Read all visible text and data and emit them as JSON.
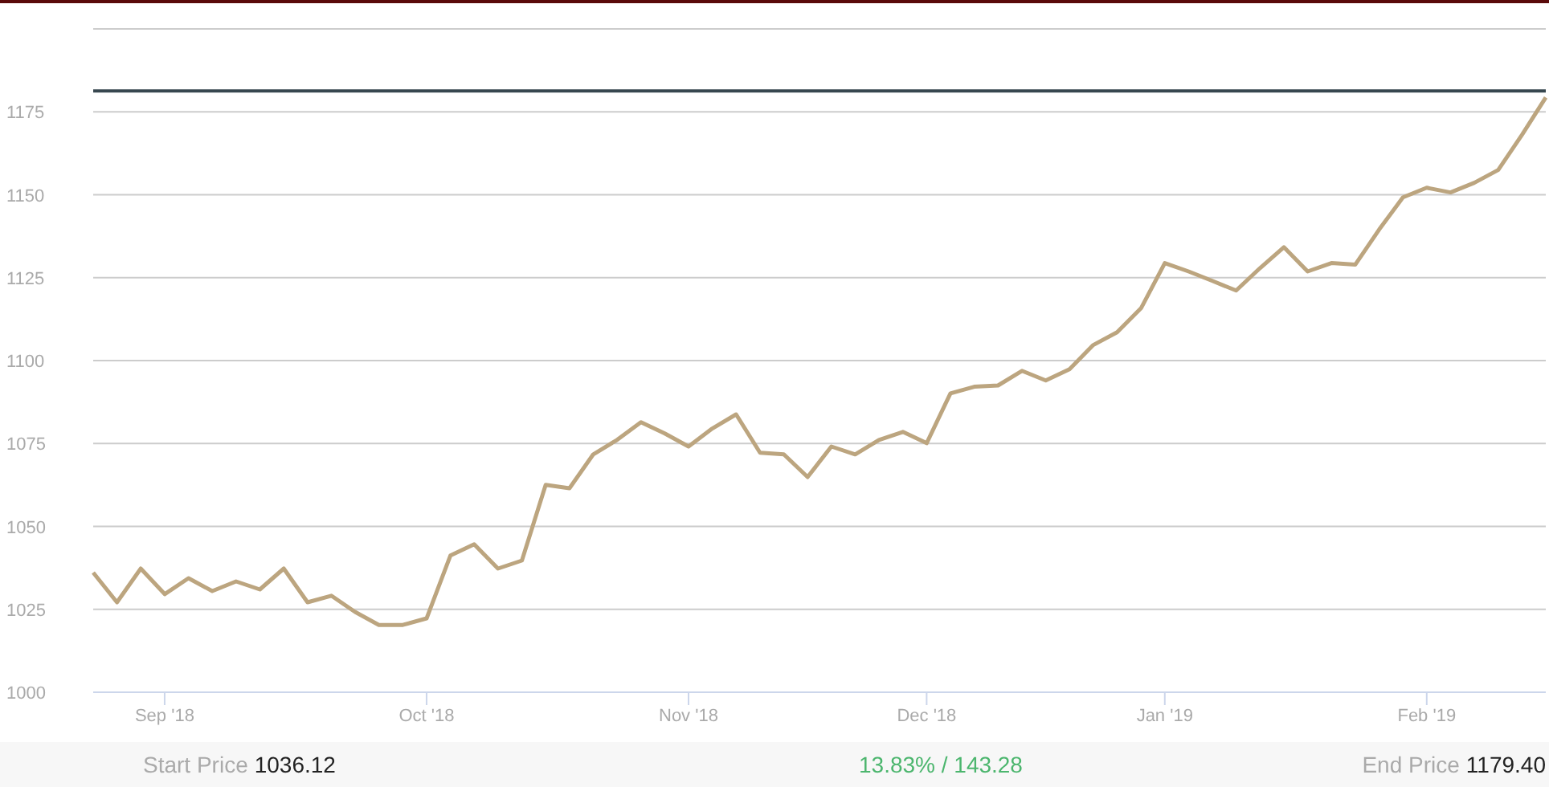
{
  "chart": {
    "chart_data": {
      "type": "line",
      "categories": [
        null,
        null,
        null,
        "Sep '18",
        null,
        null,
        null,
        null,
        null,
        null,
        null,
        null,
        null,
        null,
        "Oct '18",
        null,
        null,
        null,
        null,
        null,
        null,
        null,
        null,
        null,
        null,
        "Nov '18",
        null,
        null,
        null,
        null,
        null,
        null,
        null,
        null,
        null,
        "Dec '18",
        null,
        null,
        null,
        null,
        null,
        null,
        null,
        null,
        null,
        "Jan '19",
        null,
        null,
        null,
        null,
        null,
        null,
        null,
        null,
        null,
        null,
        "Feb '19",
        null,
        null,
        null,
        null,
        null
      ],
      "series": [
        {
          "color": "#bca57f",
          "values": [
            1036.1,
            1027.1,
            1037.3,
            1029.6,
            1034.4,
            1030.5,
            1033.4,
            1031.0,
            1037.3,
            1027.1,
            1029.1,
            1024.2,
            1020.3,
            1020.3,
            1022.3,
            1041.2,
            1044.6,
            1037.3,
            1039.7,
            1062.5,
            1061.5,
            1071.7,
            1076.1,
            1081.4,
            1078.0,
            1074.1,
            1079.5,
            1083.8,
            1072.2,
            1071.7,
            1064.9,
            1074.1,
            1071.7,
            1076.1,
            1078.5,
            1075.1,
            1090.1,
            1092.1,
            1092.5,
            1096.9,
            1094.0,
            1097.4,
            1104.7,
            1108.5,
            1115.8,
            1129.4,
            1126.9,
            1124.0,
            1121.1,
            1127.9,
            1134.2,
            1126.9,
            1129.4,
            1128.9,
            1139.5,
            1149.2,
            1152.1,
            1150.7,
            1153.6,
            1157.5,
            1168.1,
            1179.3
          ]
        },
        {
          "color": "#37474f",
          "values": [
            1181.3,
            1181.3,
            1181.3,
            1181.3,
            1181.3,
            1181.3,
            1181.3,
            1181.3,
            1181.3,
            1181.3,
            1181.3,
            1181.3,
            1181.3,
            1181.3,
            1181.3,
            1181.3,
            1181.3,
            1181.3,
            1181.3,
            1181.3,
            1181.3,
            1181.3,
            1181.3,
            1181.3,
            1181.3,
            1181.3,
            1181.3,
            1181.3,
            1181.3,
            1181.3,
            1181.3,
            1181.3,
            1181.3,
            1181.3,
            1181.3,
            1181.3,
            1181.3,
            1181.3,
            1181.3,
            1181.3,
            1181.3,
            1181.3,
            1181.3,
            1181.3,
            1181.3,
            1181.3,
            1181.3,
            1181.3,
            1181.3,
            1181.3,
            1181.3,
            1181.3,
            1181.3,
            1181.3,
            1181.3,
            1181.3,
            1181.3,
            1181.3,
            1181.3,
            1181.3,
            1181.3,
            1181.3
          ]
        }
      ],
      "grid": true,
      "yticks": [
        1000,
        1025,
        1050,
        1075,
        1100,
        1125,
        1150,
        1175
      ],
      "ylim": [
        1000,
        1200
      ]
    }
  },
  "footer": {
    "start_label": "Start Price",
    "start_value": "1036.12",
    "change": "13.83% / 143.28",
    "end_label": "End Price",
    "end_value": "1179.40"
  }
}
